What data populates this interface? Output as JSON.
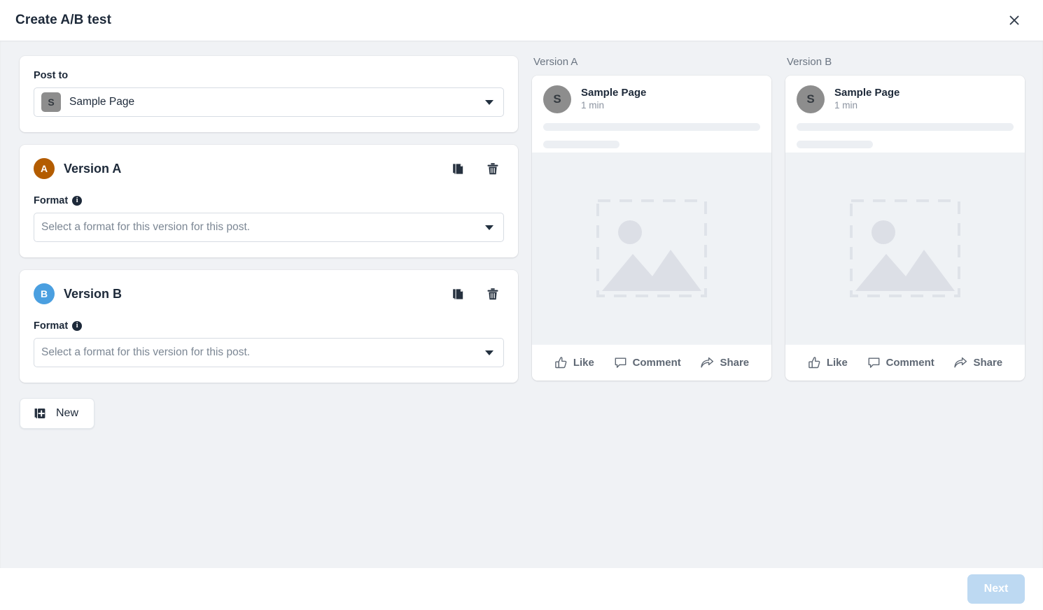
{
  "header": {
    "title": "Create A/B test",
    "close_icon": "close-icon"
  },
  "post_to": {
    "label": "Post to",
    "page_name": "Sample Page",
    "avatar_initial": "S",
    "caret_icon": "chevron-down-icon"
  },
  "versions": [
    {
      "badge_letter": "A",
      "badge_color": "#b35c00",
      "name": "Version A",
      "duplicate_icon": "duplicate-icon",
      "delete_icon": "trash-icon",
      "format_label": "Format",
      "format_info_icon": "info-icon",
      "format_placeholder": "Select a format for this version for this post."
    },
    {
      "badge_letter": "B",
      "badge_color": "#4a9fe0",
      "name": "Version B",
      "duplicate_icon": "duplicate-icon",
      "delete_icon": "trash-icon",
      "format_label": "Format",
      "format_info_icon": "info-icon",
      "format_placeholder": "Select a format for this version for this post."
    }
  ],
  "new_button": {
    "label": "New",
    "icon": "add-duplicate-icon"
  },
  "previews": [
    {
      "label": "Version A",
      "avatar_initial": "S",
      "page_name": "Sample Page",
      "timestamp": "1 min",
      "media_icon": "image-placeholder-icon",
      "actions": [
        {
          "label": "Like",
          "icon": "thumbs-up-icon"
        },
        {
          "label": "Comment",
          "icon": "comment-bubble-icon"
        },
        {
          "label": "Share",
          "icon": "share-arrow-icon"
        }
      ]
    },
    {
      "label": "Version B",
      "avatar_initial": "S",
      "page_name": "Sample Page",
      "timestamp": "1 min",
      "media_icon": "image-placeholder-icon",
      "actions": [
        {
          "label": "Like",
          "icon": "thumbs-up-icon"
        },
        {
          "label": "Comment",
          "icon": "comment-bubble-icon"
        },
        {
          "label": "Share",
          "icon": "share-arrow-icon"
        }
      ]
    }
  ],
  "footer": {
    "next_label": "Next",
    "next_disabled": true
  },
  "colors": {
    "body_background": "#f0f2f5",
    "card_background": "#ffffff",
    "text_primary": "#1d2939",
    "text_muted": "#6b7582",
    "next_button": "#bdd9f2",
    "version_a_badge": "#b35c00",
    "version_b_badge": "#4a9fe0"
  }
}
